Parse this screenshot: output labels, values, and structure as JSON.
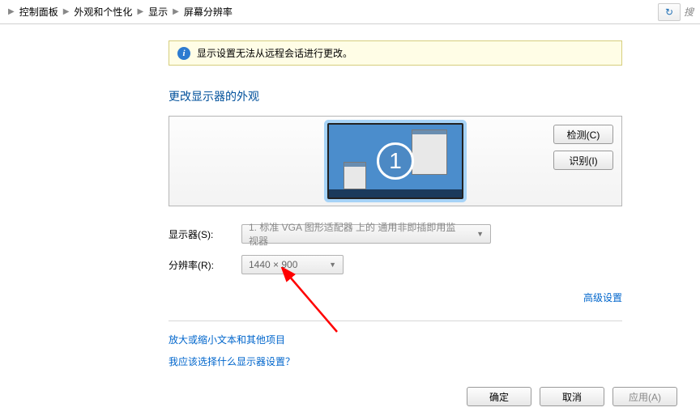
{
  "breadcrumb": {
    "items": [
      "控制面板",
      "外观和个性化",
      "显示",
      "屏幕分辨率"
    ]
  },
  "search": {
    "hint": "搜"
  },
  "banner": {
    "text": "显示设置无法从远程会话进行更改。"
  },
  "heading": "更改显示器的外观",
  "preview": {
    "display_number": "1",
    "detect_button": "检测(C)",
    "identify_button": "识别(I)"
  },
  "form": {
    "display_label": "显示器(S):",
    "display_value": "1. 标准 VGA 图形适配器 上的 通用非即插即用监视器",
    "resolution_label": "分辨率(R):",
    "resolution_value": "1440 × 900"
  },
  "links": {
    "advanced": "高级设置",
    "scale_text": "放大或缩小文本和其他项目",
    "which_display": "我应该选择什么显示器设置？"
  },
  "buttons": {
    "ok": "确定",
    "cancel": "取消",
    "apply": "应用(A)"
  }
}
